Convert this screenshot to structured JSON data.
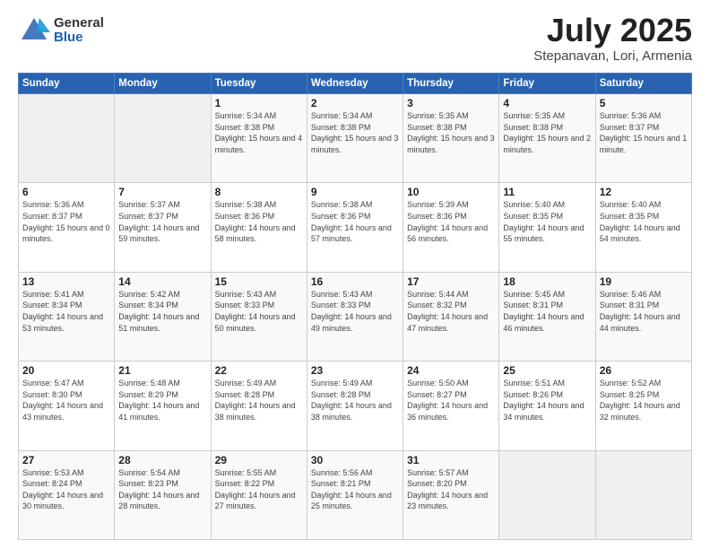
{
  "header": {
    "logo_general": "General",
    "logo_blue": "Blue",
    "title": "July 2025",
    "location": "Stepanavan, Lori, Armenia"
  },
  "days_of_week": [
    "Sunday",
    "Monday",
    "Tuesday",
    "Wednesday",
    "Thursday",
    "Friday",
    "Saturday"
  ],
  "weeks": [
    [
      {
        "day": "",
        "info": ""
      },
      {
        "day": "",
        "info": ""
      },
      {
        "day": "1",
        "info": "Sunrise: 5:34 AM\nSunset: 8:38 PM\nDaylight: 15 hours and 4 minutes."
      },
      {
        "day": "2",
        "info": "Sunrise: 5:34 AM\nSunset: 8:38 PM\nDaylight: 15 hours and 3 minutes."
      },
      {
        "day": "3",
        "info": "Sunrise: 5:35 AM\nSunset: 8:38 PM\nDaylight: 15 hours and 3 minutes."
      },
      {
        "day": "4",
        "info": "Sunrise: 5:35 AM\nSunset: 8:38 PM\nDaylight: 15 hours and 2 minutes."
      },
      {
        "day": "5",
        "info": "Sunrise: 5:36 AM\nSunset: 8:37 PM\nDaylight: 15 hours and 1 minute."
      }
    ],
    [
      {
        "day": "6",
        "info": "Sunrise: 5:36 AM\nSunset: 8:37 PM\nDaylight: 15 hours and 0 minutes."
      },
      {
        "day": "7",
        "info": "Sunrise: 5:37 AM\nSunset: 8:37 PM\nDaylight: 14 hours and 59 minutes."
      },
      {
        "day": "8",
        "info": "Sunrise: 5:38 AM\nSunset: 8:36 PM\nDaylight: 14 hours and 58 minutes."
      },
      {
        "day": "9",
        "info": "Sunrise: 5:38 AM\nSunset: 8:36 PM\nDaylight: 14 hours and 57 minutes."
      },
      {
        "day": "10",
        "info": "Sunrise: 5:39 AM\nSunset: 8:36 PM\nDaylight: 14 hours and 56 minutes."
      },
      {
        "day": "11",
        "info": "Sunrise: 5:40 AM\nSunset: 8:35 PM\nDaylight: 14 hours and 55 minutes."
      },
      {
        "day": "12",
        "info": "Sunrise: 5:40 AM\nSunset: 8:35 PM\nDaylight: 14 hours and 54 minutes."
      }
    ],
    [
      {
        "day": "13",
        "info": "Sunrise: 5:41 AM\nSunset: 8:34 PM\nDaylight: 14 hours and 53 minutes."
      },
      {
        "day": "14",
        "info": "Sunrise: 5:42 AM\nSunset: 8:34 PM\nDaylight: 14 hours and 51 minutes."
      },
      {
        "day": "15",
        "info": "Sunrise: 5:43 AM\nSunset: 8:33 PM\nDaylight: 14 hours and 50 minutes."
      },
      {
        "day": "16",
        "info": "Sunrise: 5:43 AM\nSunset: 8:33 PM\nDaylight: 14 hours and 49 minutes."
      },
      {
        "day": "17",
        "info": "Sunrise: 5:44 AM\nSunset: 8:32 PM\nDaylight: 14 hours and 47 minutes."
      },
      {
        "day": "18",
        "info": "Sunrise: 5:45 AM\nSunset: 8:31 PM\nDaylight: 14 hours and 46 minutes."
      },
      {
        "day": "19",
        "info": "Sunrise: 5:46 AM\nSunset: 8:31 PM\nDaylight: 14 hours and 44 minutes."
      }
    ],
    [
      {
        "day": "20",
        "info": "Sunrise: 5:47 AM\nSunset: 8:30 PM\nDaylight: 14 hours and 43 minutes."
      },
      {
        "day": "21",
        "info": "Sunrise: 5:48 AM\nSunset: 8:29 PM\nDaylight: 14 hours and 41 minutes."
      },
      {
        "day": "22",
        "info": "Sunrise: 5:49 AM\nSunset: 8:28 PM\nDaylight: 14 hours and 38 minutes."
      },
      {
        "day": "23",
        "info": "Sunrise: 5:49 AM\nSunset: 8:28 PM\nDaylight: 14 hours and 38 minutes."
      },
      {
        "day": "24",
        "info": "Sunrise: 5:50 AM\nSunset: 8:27 PM\nDaylight: 14 hours and 36 minutes."
      },
      {
        "day": "25",
        "info": "Sunrise: 5:51 AM\nSunset: 8:26 PM\nDaylight: 14 hours and 34 minutes."
      },
      {
        "day": "26",
        "info": "Sunrise: 5:52 AM\nSunset: 8:25 PM\nDaylight: 14 hours and 32 minutes."
      }
    ],
    [
      {
        "day": "27",
        "info": "Sunrise: 5:53 AM\nSunset: 8:24 PM\nDaylight: 14 hours and 30 minutes."
      },
      {
        "day": "28",
        "info": "Sunrise: 5:54 AM\nSunset: 8:23 PM\nDaylight: 14 hours and 28 minutes."
      },
      {
        "day": "29",
        "info": "Sunrise: 5:55 AM\nSunset: 8:22 PM\nDaylight: 14 hours and 27 minutes."
      },
      {
        "day": "30",
        "info": "Sunrise: 5:56 AM\nSunset: 8:21 PM\nDaylight: 14 hours and 25 minutes."
      },
      {
        "day": "31",
        "info": "Sunrise: 5:57 AM\nSunset: 8:20 PM\nDaylight: 14 hours and 23 minutes."
      },
      {
        "day": "",
        "info": ""
      },
      {
        "day": "",
        "info": ""
      }
    ]
  ]
}
